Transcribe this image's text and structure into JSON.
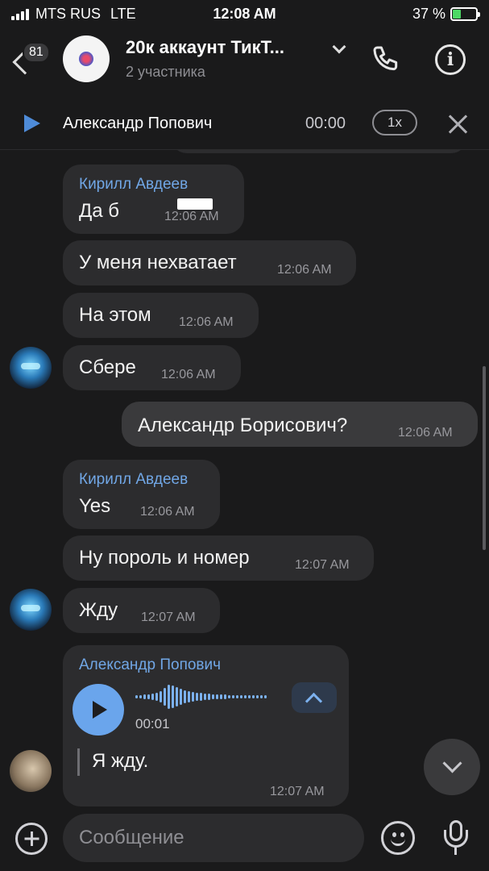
{
  "status_bar": {
    "carrier": "MTS RUS",
    "network": "LTE",
    "time": "12:08 AM",
    "battery_percent": "37 %",
    "battery_level": 0.37
  },
  "header": {
    "unread_count": "81",
    "title": "20к аккаунт ТикТ...",
    "subtitle": "2 участника",
    "info_icon_glyph": "i"
  },
  "player": {
    "author": "Александр Попович",
    "time": "00:00",
    "speed": "1x"
  },
  "messages": [
    {
      "id": "m1",
      "sender": "Кирилл Авдеев",
      "text": "Да б",
      "time": "12:06 AM"
    },
    {
      "id": "m2",
      "text": "У меня нехватает",
      "time": "12:06 AM"
    },
    {
      "id": "m3",
      "text": "На этом",
      "time": "12:06 AM"
    },
    {
      "id": "m4",
      "text": "Сбере",
      "time": "12:06 AM"
    },
    {
      "id": "m5",
      "text": "Александр Борисович?",
      "time": "12:06 AM",
      "outgoing": true
    },
    {
      "id": "m6",
      "sender": "Кирилл Авдеев",
      "text": "Yes",
      "time": "12:06 AM"
    },
    {
      "id": "m7",
      "text": "Ну пороль и номер",
      "time": "12:07 AM"
    },
    {
      "id": "m8",
      "text": "Жду",
      "time": "12:07 AM"
    },
    {
      "id": "m9",
      "sender": "Александр Попович",
      "voice_duration": "00:01",
      "transcript": "Я жду.",
      "time": "12:07 AM"
    }
  ],
  "composer": {
    "placeholder": "Сообщение"
  },
  "colors": {
    "background": "#1a1a1b",
    "bubble": "#2c2c2e",
    "accent": "#4e8bd8",
    "sender_name": "#71a7e6"
  }
}
